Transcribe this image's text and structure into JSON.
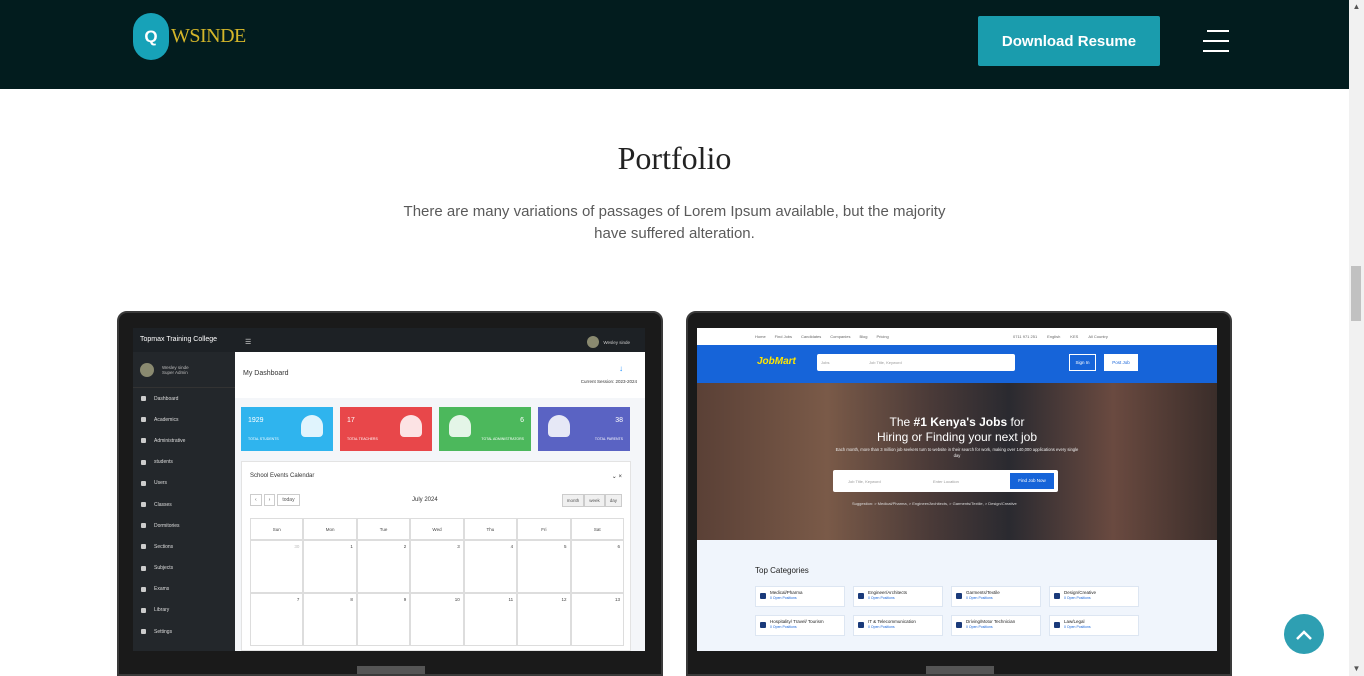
{
  "header": {
    "logo_letter": "Q",
    "logo_text": "WSINDE",
    "download_label": "Download Resume"
  },
  "section": {
    "title": "Portfolio",
    "subtitle": "There are many variations of passages of Lorem Ipsum available, but the majority have suffered alteration."
  },
  "dashboard": {
    "brand": "Topmax Training College",
    "user_name": "Wesley sinde",
    "user_role": "Super Admin",
    "top_user": "Wesley sinde",
    "page_title": "My Dashboard",
    "session": "Current Session: 2023-2024",
    "nav": [
      "Dashboard",
      "Academics",
      "Administrative",
      "students",
      "Users",
      "Classes",
      "Dormitories",
      "Sections",
      "Subjects",
      "Exams",
      "Library",
      "Settings"
    ],
    "tiles": [
      {
        "value": "1929",
        "label": "TOTAL STUDENTS",
        "color": "#2fb4ee"
      },
      {
        "value": "17",
        "label": "TOTAL TEACHERS",
        "color": "#e8474a"
      },
      {
        "value": "6",
        "label": "TOTAL ADMINISTRATORS",
        "color": "#4cb85c"
      },
      {
        "value": "38",
        "label": "TOTAL PARENTS",
        "color": "#5a63c3"
      }
    ],
    "calendar": {
      "title": "School Events Calendar",
      "today": "today",
      "month": "July 2024",
      "views": [
        "month",
        "week",
        "day"
      ],
      "days": [
        "Sun",
        "Mon",
        "Tue",
        "Wed",
        "Thu",
        "Fri",
        "Sat"
      ],
      "dates": [
        "30",
        "1",
        "2",
        "3",
        "4",
        "5",
        "6",
        "7",
        "8",
        "9",
        "10",
        "11",
        "12",
        "13"
      ]
    }
  },
  "jobmart": {
    "top_links": [
      "Home",
      "Find Jobs",
      "Candidates",
      "Companies",
      "Blog",
      "Pricing"
    ],
    "top_right": [
      "0711 971 251",
      "English",
      "KES",
      "All Country"
    ],
    "logo": "JobMart",
    "search_select": "Jobs",
    "search_placeholder": "Job Title, Keyword",
    "sign_in": "Sign In",
    "post_job": "Post Job",
    "hero_line1_pre": "The ",
    "hero_line1_bold": "#1 Kenya's Jobs",
    "hero_line1_post": " for",
    "hero_line2": "Hiring or Finding your next job",
    "hero_sub": "Each month, more than 3 million job seekers turn to website in their search for work, making over 140,000 applications every single day",
    "hero_keyword": "Job Title, Keyword",
    "hero_location": "Enter Location",
    "find_job": "Find Job Now",
    "suggestion": "Suggestion: > Medical/Pharma, > Engineer/Architects, > Garments/Textile, > Design/Creative",
    "categories_title": "Top Categories",
    "categories": [
      {
        "name": "Medical/Pharma",
        "open": "0 Open Positions"
      },
      {
        "name": "Engineer/Architects",
        "open": "0 Open Positions"
      },
      {
        "name": "Garments/Textile",
        "open": "0 Open Positions"
      },
      {
        "name": "Design/Creative",
        "open": "0 Open Positions"
      },
      {
        "name": "Hospitality/ Travel/ Tourism",
        "open": "0 Open Positions"
      },
      {
        "name": "IT & Telecommunication",
        "open": "0 Open Positions"
      },
      {
        "name": "Driving/Motor Technician",
        "open": "0 Open Positions"
      },
      {
        "name": "Law/Legal",
        "open": "0 Open Positions"
      }
    ]
  },
  "icons": {
    "menu": "hamburger-icon",
    "to_top": "chevron-up-icon"
  }
}
